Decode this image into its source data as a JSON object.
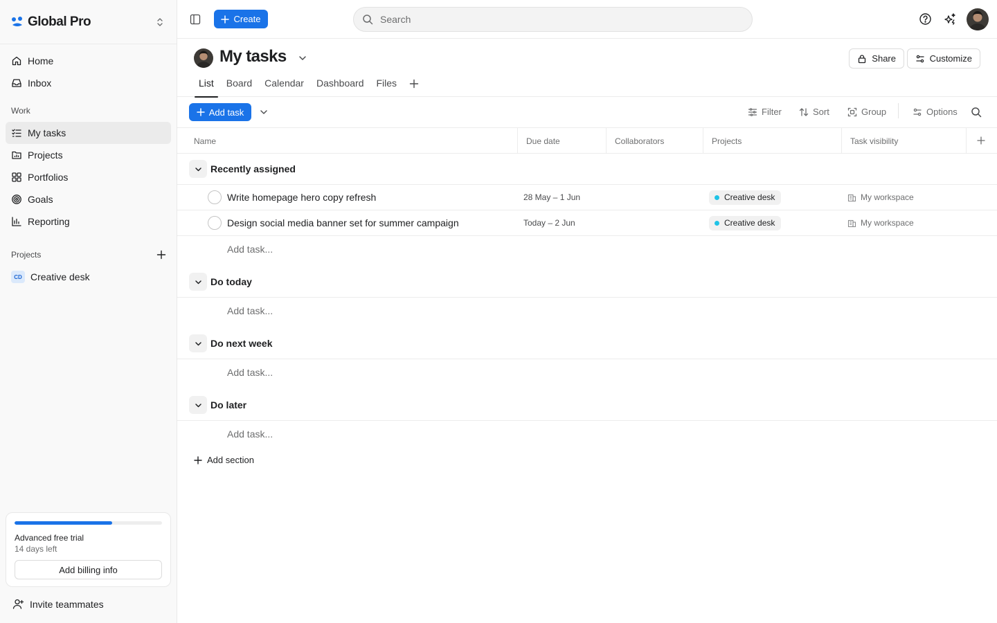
{
  "brand": {
    "name": "Global Pro"
  },
  "nav": {
    "home": "Home",
    "inbox": "Inbox",
    "work_label": "Work",
    "my_tasks": "My tasks",
    "projects": "Projects",
    "portfolios": "Portfolios",
    "goals": "Goals",
    "reporting": "Reporting",
    "projects_label": "Projects",
    "project_items": [
      {
        "badge": "CD",
        "label": "Creative desk"
      }
    ]
  },
  "trial": {
    "progress": 0.66,
    "title": "Advanced free trial",
    "subtitle": "14 days left",
    "button": "Add billing info"
  },
  "invite": "Invite teammates",
  "topbar": {
    "create": "Create",
    "search_placeholder": "Search"
  },
  "page": {
    "title": "My tasks",
    "share": "Share",
    "customize": "Customize",
    "tabs": [
      "List",
      "Board",
      "Calendar",
      "Dashboard",
      "Files"
    ],
    "active_tab": "List"
  },
  "toolbar": {
    "add_task": "Add task",
    "filter": "Filter",
    "sort": "Sort",
    "group": "Group",
    "options": "Options"
  },
  "columns": [
    "Name",
    "Due date",
    "Collaborators",
    "Projects",
    "Task visibility"
  ],
  "sections": [
    {
      "title": "Recently assigned",
      "tasks": [
        {
          "name": "Write homepage hero copy refresh",
          "due": "28 May – 1 Jun",
          "project": "Creative desk",
          "project_color": "#1fc3e6",
          "visibility": "My workspace"
        },
        {
          "name": "Design social media banner set for summer campaign",
          "due": "Today – 2 Jun",
          "project": "Creative desk",
          "project_color": "#1fc3e6",
          "visibility": "My workspace"
        }
      ],
      "add_task": "Add task..."
    },
    {
      "title": "Do today",
      "tasks": [],
      "add_task": "Add task..."
    },
    {
      "title": "Do next week",
      "tasks": [],
      "add_task": "Add task..."
    },
    {
      "title": "Do later",
      "tasks": [],
      "add_task": "Add task..."
    }
  ],
  "add_section": "Add section",
  "colors": {
    "accent": "#1a73e8",
    "project_dot": "#1fc3e6"
  }
}
